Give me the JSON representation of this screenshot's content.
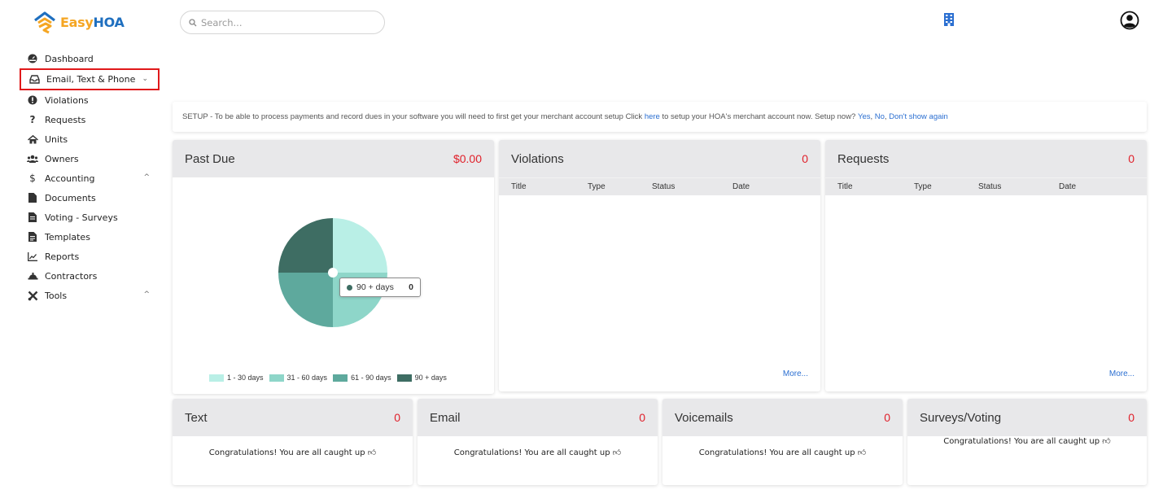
{
  "brand": {
    "easy": "Easy",
    "hoa": "HOA"
  },
  "search": {
    "placeholder": "Search..."
  },
  "sidebar": {
    "items": [
      {
        "label": "Dashboard",
        "icon": "dashboard-icon"
      },
      {
        "label": "Email, Text & Phone",
        "icon": "inbox-icon",
        "chevron": "⌄"
      },
      {
        "label": "Violations",
        "icon": "alert-icon"
      },
      {
        "label": "Requests",
        "icon": "question-icon"
      },
      {
        "label": "Units",
        "icon": "home-icon"
      },
      {
        "label": "Owners",
        "icon": "users-icon"
      },
      {
        "label": "Accounting",
        "icon": "dollar-icon",
        "chevron": "^"
      },
      {
        "label": "Documents",
        "icon": "document-icon"
      },
      {
        "label": "Voting - Surveys",
        "icon": "ballot-icon"
      },
      {
        "label": "Templates",
        "icon": "template-icon"
      },
      {
        "label": "Reports",
        "icon": "chart-icon"
      },
      {
        "label": "Contractors",
        "icon": "hardhat-icon"
      },
      {
        "label": "Tools",
        "icon": "tools-icon",
        "chevron": "^"
      }
    ]
  },
  "banner": {
    "pre": "SETUP - To be able to process payments and record dues in your software you will need to first get your merchant account setup Click ",
    "here": "here",
    "post": " to setup your HOA's merchant account now. Setup now? ",
    "yes": "Yes",
    "no": "No",
    "dont_show": "Don't show again"
  },
  "cards": {
    "past_due": {
      "title": "Past Due",
      "value": "$0.00"
    },
    "violations": {
      "title": "Violations",
      "value": "0",
      "columns": [
        "Title",
        "Type",
        "Status",
        "Date"
      ],
      "more": "More..."
    },
    "requests": {
      "title": "Requests",
      "value": "0",
      "columns": [
        "Title",
        "Type",
        "Status",
        "Date"
      ],
      "more": "More..."
    },
    "text": {
      "title": "Text",
      "value": "0",
      "message": "Congratulations! You are all caught up"
    },
    "email": {
      "title": "Email",
      "value": "0",
      "message": "Congratulations! You are all caught up"
    },
    "voicemails": {
      "title": "Voicemails",
      "value": "0",
      "message": "Congratulations! You are all caught up"
    },
    "surveys": {
      "title": "Surveys/Voting",
      "value": "0",
      "message": "Congratulations! You are all caught up"
    }
  },
  "chart_data": {
    "type": "pie",
    "categories": [
      "1 - 30 days",
      "31 - 60 days",
      "61 - 90 days",
      "90 + days"
    ],
    "values": [
      1,
      1,
      1,
      1
    ],
    "colors": [
      "#b9efe6",
      "#8ed6c9",
      "#5ea99d",
      "#3e6d63"
    ],
    "legend": "bottom",
    "tooltip": {
      "label": "90 + days",
      "value": "0"
    }
  },
  "colors": {
    "accent_red": "#e0202a",
    "link": "#2b6fd1",
    "highlight": "#e0191b"
  }
}
